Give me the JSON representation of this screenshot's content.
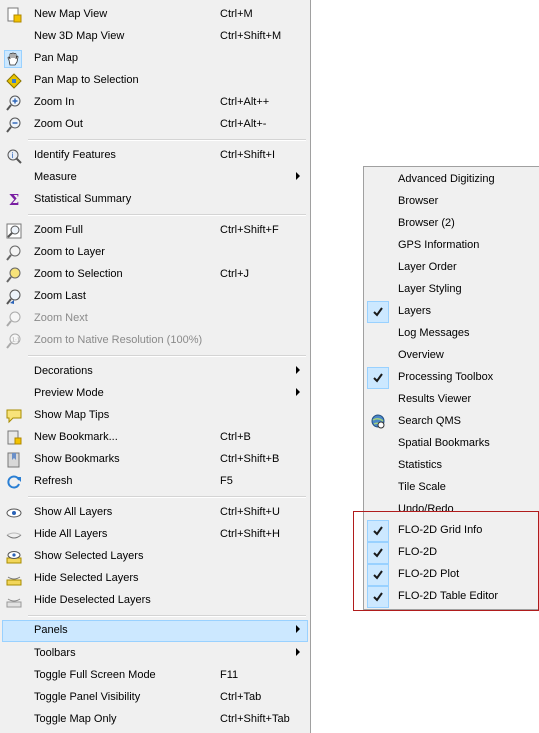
{
  "menu": {
    "items": [
      {
        "label": "New Map View",
        "shortcut": "Ctrl+M",
        "icon": "new-map-view-icon"
      },
      {
        "label": "New 3D Map View",
        "shortcut": "Ctrl+Shift+M",
        "icon": ""
      },
      {
        "label": "Pan Map",
        "shortcut": "",
        "icon": "pan-hand-icon"
      },
      {
        "label": "Pan Map to Selection",
        "shortcut": "",
        "icon": "pan-selection-icon"
      },
      {
        "label": "Zoom In",
        "shortcut": "Ctrl+Alt++",
        "icon": "zoom-in-icon"
      },
      {
        "label": "Zoom Out",
        "shortcut": "Ctrl+Alt+-",
        "icon": "zoom-out-icon"
      },
      {
        "label": "Identify Features",
        "shortcut": "Ctrl+Shift+I",
        "icon": "identify-icon"
      },
      {
        "label": "Measure",
        "shortcut": "",
        "icon": ""
      },
      {
        "label": "Statistical Summary",
        "shortcut": "",
        "icon": "sigma-icon"
      },
      {
        "label": "Zoom Full",
        "shortcut": "Ctrl+Shift+F",
        "icon": "zoom-full-icon"
      },
      {
        "label": "Zoom to Layer",
        "shortcut": "",
        "icon": "zoom-layer-icon"
      },
      {
        "label": "Zoom to Selection",
        "shortcut": "Ctrl+J",
        "icon": "zoom-selection-icon"
      },
      {
        "label": "Zoom Last",
        "shortcut": "",
        "icon": "zoom-last-icon"
      },
      {
        "label": "Zoom Next",
        "shortcut": "",
        "icon": "zoom-next-icon"
      },
      {
        "label": "Zoom to Native Resolution (100%)",
        "shortcut": "",
        "icon": "zoom-native-icon"
      },
      {
        "label": "Decorations",
        "shortcut": "",
        "icon": ""
      },
      {
        "label": "Preview Mode",
        "shortcut": "",
        "icon": ""
      },
      {
        "label": "Show Map Tips",
        "shortcut": "",
        "icon": "map-tips-icon"
      },
      {
        "label": "New Bookmark...",
        "shortcut": "Ctrl+B",
        "icon": "new-bookmark-icon"
      },
      {
        "label": "Show Bookmarks",
        "shortcut": "Ctrl+Shift+B",
        "icon": "bookmarks-icon"
      },
      {
        "label": "Refresh",
        "shortcut": "F5",
        "icon": "refresh-icon"
      },
      {
        "label": "Show All Layers",
        "shortcut": "Ctrl+Shift+U",
        "icon": "show-all-layers-icon"
      },
      {
        "label": "Hide All Layers",
        "shortcut": "Ctrl+Shift+H",
        "icon": "hide-all-layers-icon"
      },
      {
        "label": "Show Selected Layers",
        "shortcut": "",
        "icon": "show-selected-layers-icon"
      },
      {
        "label": "Hide Selected Layers",
        "shortcut": "",
        "icon": "hide-selected-layers-icon"
      },
      {
        "label": "Hide Deselected Layers",
        "shortcut": "",
        "icon": "hide-deselected-layers-icon"
      },
      {
        "label": "Panels",
        "shortcut": "",
        "icon": ""
      },
      {
        "label": "Toolbars",
        "shortcut": "",
        "icon": ""
      },
      {
        "label": "Toggle Full Screen Mode",
        "shortcut": "F11",
        "icon": ""
      },
      {
        "label": "Toggle Panel Visibility",
        "shortcut": "Ctrl+Tab",
        "icon": ""
      },
      {
        "label": "Toggle Map Only",
        "shortcut": "Ctrl+Shift+Tab",
        "icon": ""
      }
    ]
  },
  "panels": {
    "items": [
      {
        "label": "Advanced Digitizing",
        "checked": false
      },
      {
        "label": "Browser",
        "checked": false
      },
      {
        "label": "Browser (2)",
        "checked": false
      },
      {
        "label": "GPS Information",
        "checked": false
      },
      {
        "label": "Layer Order",
        "checked": false
      },
      {
        "label": "Layer Styling",
        "checked": false
      },
      {
        "label": "Layers",
        "checked": true
      },
      {
        "label": "Log Messages",
        "checked": false
      },
      {
        "label": "Overview",
        "checked": false
      },
      {
        "label": "Processing Toolbox",
        "checked": true
      },
      {
        "label": "Results Viewer",
        "checked": false
      },
      {
        "label": "Search QMS",
        "checked": false,
        "icon": "search-qms-icon"
      },
      {
        "label": "Spatial Bookmarks",
        "checked": false
      },
      {
        "label": "Statistics",
        "checked": false
      },
      {
        "label": "Tile Scale",
        "checked": false
      },
      {
        "label": "Undo/Redo",
        "checked": false
      },
      {
        "label": "FLO-2D Grid Info",
        "checked": true
      },
      {
        "label": "FLO-2D",
        "checked": true
      },
      {
        "label": "FLO-2D Plot",
        "checked": true
      },
      {
        "label": "FLO-2D Table Editor",
        "checked": true
      }
    ]
  },
  "colors": {
    "highlight": "#cce8ff",
    "highlight_border": "#99d1ff",
    "callout_border": "#b01c1c"
  }
}
